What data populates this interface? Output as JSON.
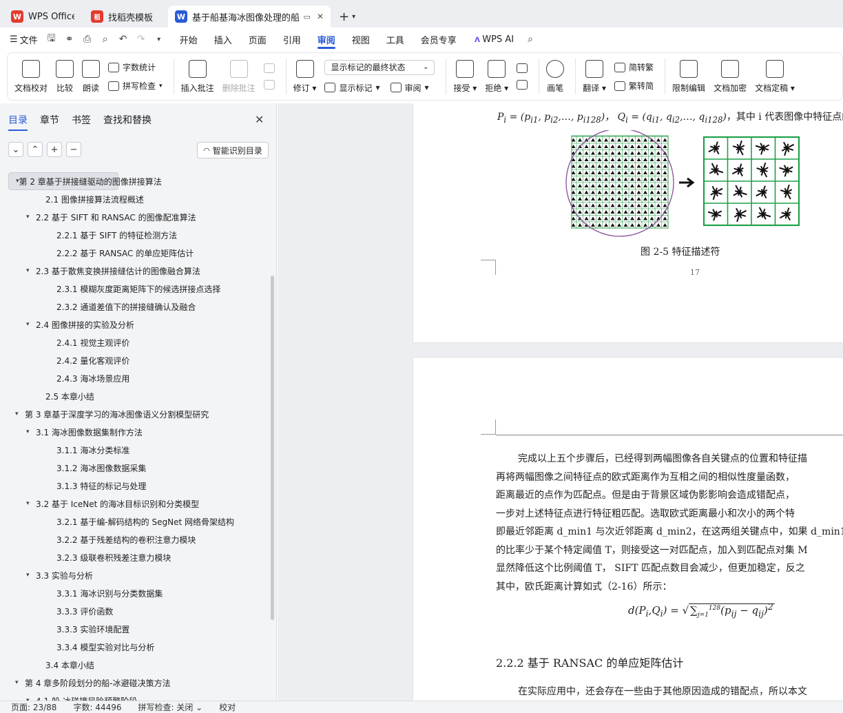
{
  "tabs": [
    {
      "label": "WPS Office",
      "logo": "W",
      "color": "#e33b2e"
    },
    {
      "label": "找稻壳模板",
      "logo": "稻",
      "color": "#e33b2e"
    },
    {
      "label": "基于船基海冰图像处理的船-冰",
      "logo": "W",
      "color": "#2a5bd7"
    }
  ],
  "menu": {
    "file": "文件",
    "tabs": [
      "开始",
      "插入",
      "页面",
      "引用",
      "审阅",
      "视图",
      "工具",
      "会员专享"
    ],
    "active_tab": "审阅",
    "wps_ai": "WPS AI"
  },
  "ribbon": {
    "doc_check": "文档校对",
    "compare": "比较",
    "read": "朗读",
    "word_count": "字数统计",
    "spell_check": "拼写检查",
    "insert_comment": "插入批注",
    "delete_comment": "删除批注",
    "revise": "修订",
    "markup_select": "显示标记的最终状态",
    "show_markup": "显示标记",
    "review": "审阅",
    "accept": "接受",
    "reject": "拒绝",
    "pen": "画笔",
    "translate": "翻译",
    "to_traditional": "简转繁",
    "to_simplified": "繁转简",
    "restrict_edit": "限制编辑",
    "encrypt": "文档加密",
    "finalize": "文档定稿"
  },
  "panel": {
    "tabs": [
      "目录",
      "章节",
      "书签",
      "查找和替换"
    ],
    "smart_toc": "智能识别目录",
    "toc": [
      {
        "text": "第 2 章基于拼接缝驱动的图像拼接算法",
        "level": 0,
        "arrow": "▾",
        "selected": true
      },
      {
        "text": "2.1  图像拼接算法流程概述",
        "level": 1,
        "arrow": ""
      },
      {
        "text": "2.2  基于 SIFT 和 RANSAC 的图像配准算法",
        "level": 1,
        "arrow": "▾"
      },
      {
        "text": "2.2.1  基于 SIFT 的特征检测方法",
        "level": 2,
        "arrow": ""
      },
      {
        "text": "2.2.2  基于 RANSAC 的单应矩阵估计",
        "level": 2,
        "arrow": ""
      },
      {
        "text": "2.3  基于散焦变换拼接缝估计的图像融合算法",
        "level": 1,
        "arrow": "▾"
      },
      {
        "text": "2.3.1  模糊灰度距离矩阵下的候选拼接点选择",
        "level": 2,
        "arrow": ""
      },
      {
        "text": "2.3.2  通道差值下的拼接缝确认及融合",
        "level": 2,
        "arrow": ""
      },
      {
        "text": "2.4  图像拼接的实验及分析",
        "level": 1,
        "arrow": "▾"
      },
      {
        "text": "2.4.1  视觉主观评价",
        "level": 2,
        "arrow": ""
      },
      {
        "text": "2.4.2  量化客观评价",
        "level": 2,
        "arrow": ""
      },
      {
        "text": "2.4.3  海冰场景应用",
        "level": 2,
        "arrow": ""
      },
      {
        "text": "2.5  本章小结",
        "level": 1,
        "arrow": ""
      },
      {
        "text": "第 3 章基于深度学习的海冰图像语义分割模型研究",
        "level": 0,
        "arrow": "▾"
      },
      {
        "text": "3.1  海冰图像数据集制作方法",
        "level": 1,
        "arrow": "▾"
      },
      {
        "text": "3.1.1  海冰分类标准",
        "level": 2,
        "arrow": ""
      },
      {
        "text": "3.1.2  海冰图像数据采集",
        "level": 2,
        "arrow": ""
      },
      {
        "text": "3.1.3  特征的标记与处理",
        "level": 2,
        "arrow": ""
      },
      {
        "text": "3.2  基于 IceNet 的海冰目标识别和分类模型",
        "level": 1,
        "arrow": "▾"
      },
      {
        "text": "3.2.1  基于编-解码结构的 SegNet 网络骨架结构",
        "level": 2,
        "arrow": ""
      },
      {
        "text": "3.2.2  基于残差结构的卷积注意力模块",
        "level": 2,
        "arrow": ""
      },
      {
        "text": "3.2.3  级联卷积残差注意力模块",
        "level": 2,
        "arrow": ""
      },
      {
        "text": "3.3  实验与分析",
        "level": 1,
        "arrow": "▾"
      },
      {
        "text": "3.3.1  海冰识别与分类数据集",
        "level": 2,
        "arrow": ""
      },
      {
        "text": "3.3.3  评价函数",
        "level": 2,
        "arrow": ""
      },
      {
        "text": "3.3.3  实验环境配置",
        "level": 2,
        "arrow": ""
      },
      {
        "text": "3.3.4  模型实验对比与分析",
        "level": 2,
        "arrow": ""
      },
      {
        "text": "3.4  本章小结",
        "level": 1,
        "arrow": ""
      },
      {
        "text": "第 4 章多阶段划分的船-冰避碰决策方法",
        "level": 0,
        "arrow": "▾"
      },
      {
        "text": "4.1  船-冰碰撞风险预警阶段",
        "level": 1,
        "arrow": "▾"
      }
    ]
  },
  "doc": {
    "eq_tail": "，其中 i 代表图像中特征点的次",
    "fig_caption": "图 2-5  特征描述符",
    "page_number": "17",
    "paragraph": [
      "完成以上五个步骤后，已经得到两幅图像各自关键点的位置和特征描",
      "再将两幅图像之间特征点的欧式距离作为互相之间的相似性度量函数，",
      "距离最近的点作为匹配点。但是由于背景区域伪影影响会造成错配点，",
      "一步对上述特征点进行特征粗匹配。选取欧式距离最小和次小的两个特",
      "即最近邻距离 d_min1 与次近邻距离 d_min2，在这两组关键点中，如果 d_min1/d",
      "的比率少于某个特定阈值 T，则接受这一对匹配点，加入到匹配点对集 M",
      "显然降低这个比例阈值 T， SIFT 匹配点数目会减少，但更加稳定，反之",
      "其中，欧氏距离计算如式（2-16）所示："
    ],
    "heading": "2.2.2  基于 RANSAC 的单应矩阵估计",
    "last_line": "在实际应用中，还会存在一些由于其他原因造成的错配点，所以本文"
  },
  "status": {
    "page": "页面: 23/88",
    "words": "字数: 44496",
    "spell": "拼写检查: 关闭",
    "proof": "校对"
  }
}
